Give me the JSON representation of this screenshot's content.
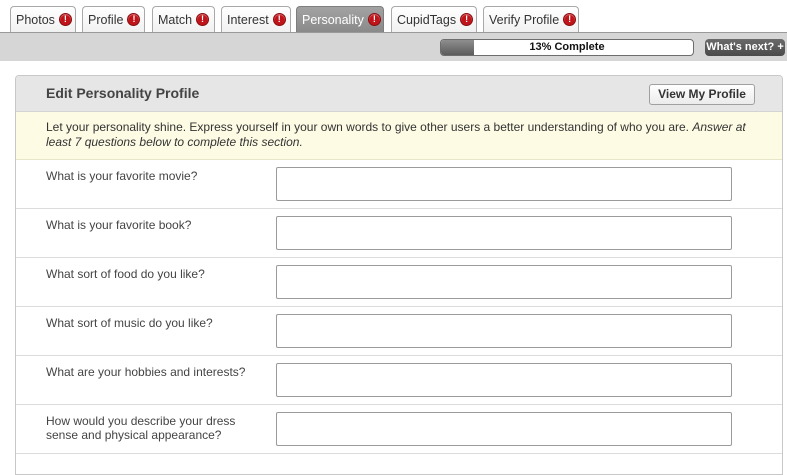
{
  "tabs": [
    {
      "label": "Photos",
      "alert": "!"
    },
    {
      "label": "Profile",
      "alert": "!"
    },
    {
      "label": "Match",
      "alert": "!"
    },
    {
      "label": "Interest",
      "alert": "!"
    },
    {
      "label": "Personality",
      "alert": "!",
      "active": true
    },
    {
      "label": "CupidTags",
      "alert": "!"
    },
    {
      "label": "Verify Profile",
      "alert": "!"
    }
  ],
  "progress": {
    "percent": 13,
    "label": "13% Complete",
    "whats_next": "What's next? +"
  },
  "panel": {
    "title": "Edit Personality Profile",
    "view_profile_label": "View My Profile",
    "intro_text": "Let your personality shine. Express yourself in your own words to give other users a better understanding of who you are.",
    "intro_emphasis": "Answer at least 7 questions below to complete this section."
  },
  "questions": [
    {
      "label": "What is your favorite movie?",
      "value": ""
    },
    {
      "label": "What is your favorite book?",
      "value": ""
    },
    {
      "label": "What sort of food do you like?",
      "value": ""
    },
    {
      "label": "What sort of music do you like?",
      "value": ""
    },
    {
      "label": "What are your hobbies and interests?",
      "value": ""
    },
    {
      "label": "How would you describe your dress sense and physical appearance?",
      "value": ""
    }
  ],
  "colors": {
    "alert_red": "#c0141a",
    "active_tab": "#8a8a8a",
    "intro_bg": "#fdfbe4"
  }
}
